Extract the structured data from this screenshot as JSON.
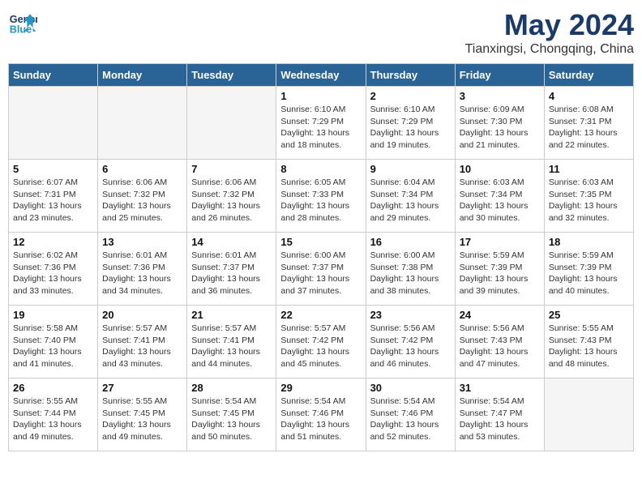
{
  "header": {
    "logo_line1": "General",
    "logo_line2": "Blue",
    "month": "May 2024",
    "location": "Tianxingsi, Chongqing, China"
  },
  "weekdays": [
    "Sunday",
    "Monday",
    "Tuesday",
    "Wednesday",
    "Thursday",
    "Friday",
    "Saturday"
  ],
  "weeks": [
    [
      {
        "day": "",
        "empty": true
      },
      {
        "day": "",
        "empty": true
      },
      {
        "day": "",
        "empty": true
      },
      {
        "day": "1",
        "sunrise": "6:10 AM",
        "sunset": "7:29 PM",
        "daylight": "13 hours and 18 minutes."
      },
      {
        "day": "2",
        "sunrise": "6:10 AM",
        "sunset": "7:29 PM",
        "daylight": "13 hours and 19 minutes."
      },
      {
        "day": "3",
        "sunrise": "6:09 AM",
        "sunset": "7:30 PM",
        "daylight": "13 hours and 21 minutes."
      },
      {
        "day": "4",
        "sunrise": "6:08 AM",
        "sunset": "7:31 PM",
        "daylight": "13 hours and 22 minutes."
      }
    ],
    [
      {
        "day": "5",
        "sunrise": "6:07 AM",
        "sunset": "7:31 PM",
        "daylight": "13 hours and 23 minutes."
      },
      {
        "day": "6",
        "sunrise": "6:06 AM",
        "sunset": "7:32 PM",
        "daylight": "13 hours and 25 minutes."
      },
      {
        "day": "7",
        "sunrise": "6:06 AM",
        "sunset": "7:32 PM",
        "daylight": "13 hours and 26 minutes."
      },
      {
        "day": "8",
        "sunrise": "6:05 AM",
        "sunset": "7:33 PM",
        "daylight": "13 hours and 28 minutes."
      },
      {
        "day": "9",
        "sunrise": "6:04 AM",
        "sunset": "7:34 PM",
        "daylight": "13 hours and 29 minutes."
      },
      {
        "day": "10",
        "sunrise": "6:03 AM",
        "sunset": "7:34 PM",
        "daylight": "13 hours and 30 minutes."
      },
      {
        "day": "11",
        "sunrise": "6:03 AM",
        "sunset": "7:35 PM",
        "daylight": "13 hours and 32 minutes."
      }
    ],
    [
      {
        "day": "12",
        "sunrise": "6:02 AM",
        "sunset": "7:36 PM",
        "daylight": "13 hours and 33 minutes."
      },
      {
        "day": "13",
        "sunrise": "6:01 AM",
        "sunset": "7:36 PM",
        "daylight": "13 hours and 34 minutes."
      },
      {
        "day": "14",
        "sunrise": "6:01 AM",
        "sunset": "7:37 PM",
        "daylight": "13 hours and 36 minutes."
      },
      {
        "day": "15",
        "sunrise": "6:00 AM",
        "sunset": "7:37 PM",
        "daylight": "13 hours and 37 minutes."
      },
      {
        "day": "16",
        "sunrise": "6:00 AM",
        "sunset": "7:38 PM",
        "daylight": "13 hours and 38 minutes."
      },
      {
        "day": "17",
        "sunrise": "5:59 AM",
        "sunset": "7:39 PM",
        "daylight": "13 hours and 39 minutes."
      },
      {
        "day": "18",
        "sunrise": "5:59 AM",
        "sunset": "7:39 PM",
        "daylight": "13 hours and 40 minutes."
      }
    ],
    [
      {
        "day": "19",
        "sunrise": "5:58 AM",
        "sunset": "7:40 PM",
        "daylight": "13 hours and 41 minutes."
      },
      {
        "day": "20",
        "sunrise": "5:57 AM",
        "sunset": "7:41 PM",
        "daylight": "13 hours and 43 minutes."
      },
      {
        "day": "21",
        "sunrise": "5:57 AM",
        "sunset": "7:41 PM",
        "daylight": "13 hours and 44 minutes."
      },
      {
        "day": "22",
        "sunrise": "5:57 AM",
        "sunset": "7:42 PM",
        "daylight": "13 hours and 45 minutes."
      },
      {
        "day": "23",
        "sunrise": "5:56 AM",
        "sunset": "7:42 PM",
        "daylight": "13 hours and 46 minutes."
      },
      {
        "day": "24",
        "sunrise": "5:56 AM",
        "sunset": "7:43 PM",
        "daylight": "13 hours and 47 minutes."
      },
      {
        "day": "25",
        "sunrise": "5:55 AM",
        "sunset": "7:43 PM",
        "daylight": "13 hours and 48 minutes."
      }
    ],
    [
      {
        "day": "26",
        "sunrise": "5:55 AM",
        "sunset": "7:44 PM",
        "daylight": "13 hours and 49 minutes."
      },
      {
        "day": "27",
        "sunrise": "5:55 AM",
        "sunset": "7:45 PM",
        "daylight": "13 hours and 49 minutes."
      },
      {
        "day": "28",
        "sunrise": "5:54 AM",
        "sunset": "7:45 PM",
        "daylight": "13 hours and 50 minutes."
      },
      {
        "day": "29",
        "sunrise": "5:54 AM",
        "sunset": "7:46 PM",
        "daylight": "13 hours and 51 minutes."
      },
      {
        "day": "30",
        "sunrise": "5:54 AM",
        "sunset": "7:46 PM",
        "daylight": "13 hours and 52 minutes."
      },
      {
        "day": "31",
        "sunrise": "5:54 AM",
        "sunset": "7:47 PM",
        "daylight": "13 hours and 53 minutes."
      },
      {
        "day": "",
        "empty": true
      }
    ]
  ]
}
